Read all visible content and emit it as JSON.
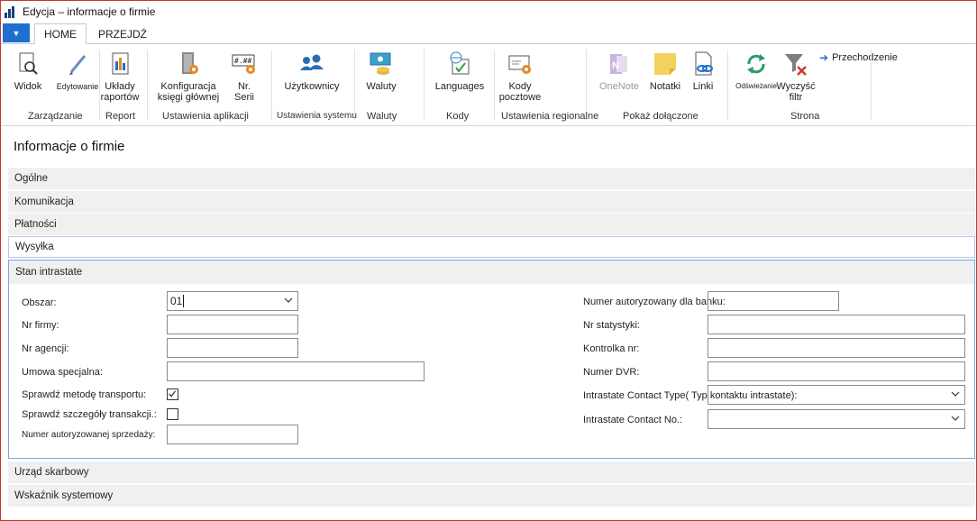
{
  "window": {
    "title": "Edycja – informacje o firmie"
  },
  "tabs": [
    {
      "label": "HOME"
    },
    {
      "label": "PRZEJDŹ"
    }
  ],
  "ribbon": {
    "buttons": {
      "widok": "Widok",
      "edytowanie": "Edytowanie",
      "uklady": [
        "Układy",
        "raportów"
      ],
      "konfiguracja": [
        "Konfiguracja",
        "księgi głównej"
      ],
      "nrserii": [
        "Nr.",
        "Serii"
      ],
      "uzytkownicy": "Użytkownicy",
      "waluty": "Waluty",
      "languages": "Languages",
      "kody": [
        "Kody",
        "pocztowe"
      ],
      "onenote": "OneNote",
      "notatki": "Notatki",
      "linki": "Linki",
      "odswiezanie": "Odświeżanie",
      "wyczysc": [
        "Wyczyść",
        "filtr"
      ],
      "przechodzenie": "Przechodzenie"
    },
    "groups": {
      "zarzadzanie": "Zarządzanie",
      "report": "Report",
      "ustawienia_aplikacji": "Ustawienia aplikacji",
      "ustawienia_systemu": "Ustawienia systemu",
      "waluty": "Waluty",
      "kody": "Kody",
      "ustawienia_regionalne": "Ustawienia regionalne",
      "pokaz_dolaczone": "Pokaż dołączone",
      "strona": "Strona"
    }
  },
  "page": {
    "title": "Informacje o firmie"
  },
  "fasttabs": {
    "ogolne": "Ogólne",
    "komunikacja": "Komunikacja",
    "platnosci": "Płatności",
    "wysylka": "Wysyłka",
    "stan_intrastate": "Stan intrastate",
    "urzad": "Urząd skarbowy",
    "wskaznik": "Wskaźnik systemowy"
  },
  "intrastate": {
    "left": {
      "obszar_label": "Obszar:",
      "obszar_value": "01",
      "nr_firmy_label": "Nr firmy:",
      "nr_agencji_label": "Nr agencji:",
      "umowa_label": "Umowa specjalna:",
      "sprawdz_metode_label": "Sprawdź metodę transportu:",
      "sprawdz_metode_checked": true,
      "sprawdz_szczegoly_label": "Sprawdź szczegóły transakcji.:",
      "sprawdz_szczegoly_checked": false,
      "numer_aut_sprzedazy_label": "Numer autoryzowanej sprzedaży:"
    },
    "right": {
      "numer_aut_banku_label": "Numer autoryzowany dla banku:",
      "nr_statystyki_label": "Nr statystyki:",
      "kontrolka_label": "Kontrolka nr:",
      "numer_dvr_label": "Numer DVR:",
      "contact_type_label": "Intrastate Contact Type( Typ kontaktu intrastate):",
      "contact_no_label": "Intrastate Contact No.:"
    }
  },
  "colors": {
    "accent": "#1f6fd0",
    "selection_border": "#7aa7e0",
    "window_border": "#c0392b"
  }
}
